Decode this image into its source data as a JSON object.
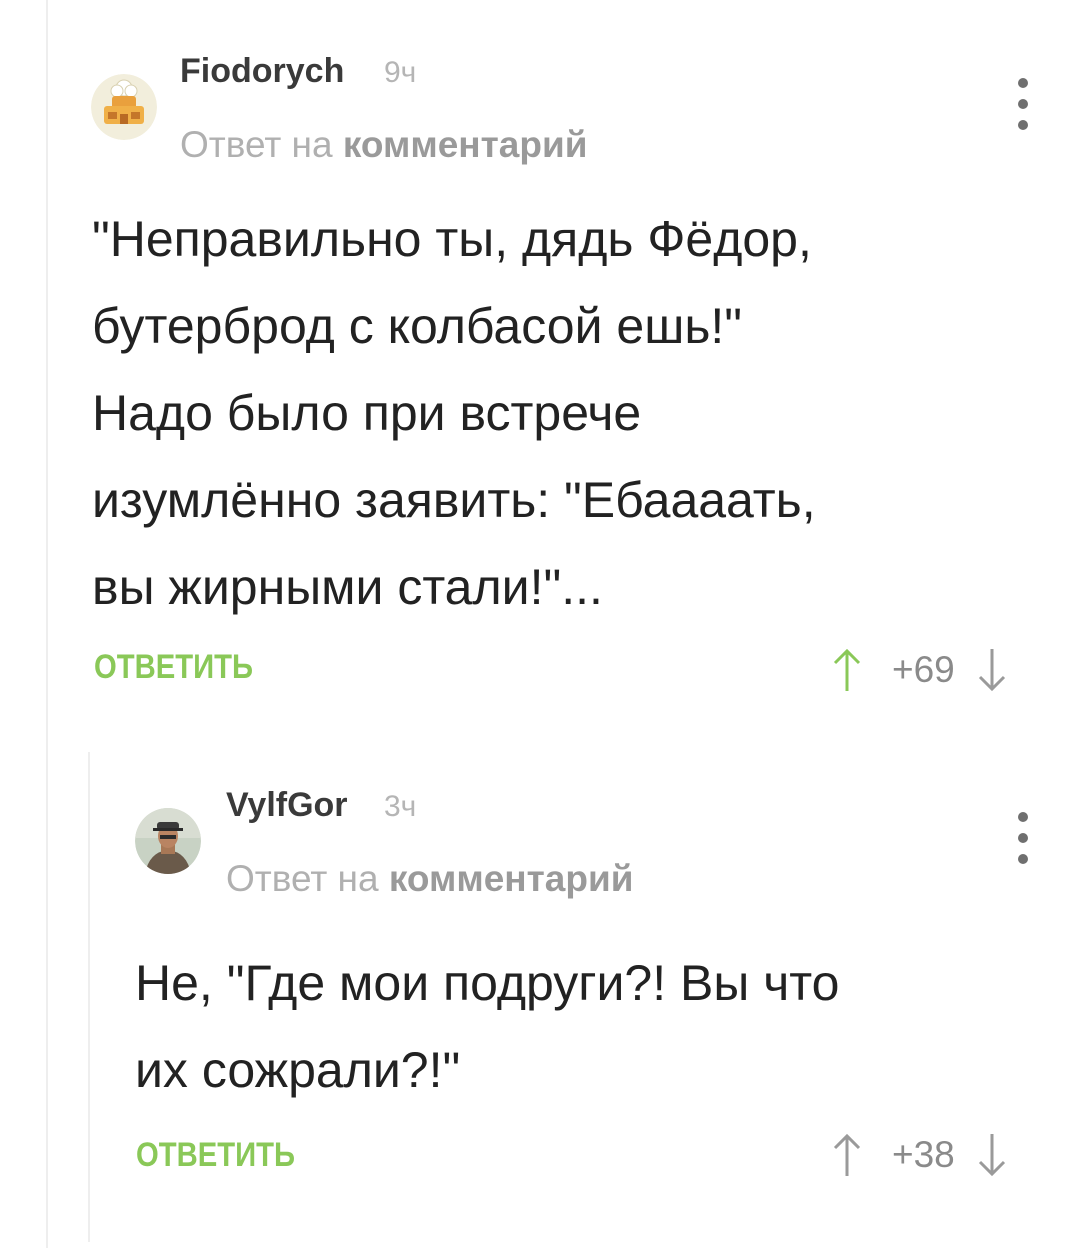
{
  "comments": [
    {
      "author": "Fiodorych",
      "time": "9ч",
      "reply_prefix": "Ответ на",
      "reply_link": "комментарий",
      "text": "\"Неправильно ты, дядь Фёдор,\nбутерброд с колбасой ешь!\"\nНадо было при встрече\nизумлённо заявить: \"Ебаааать,\nвы жирными стали!\"...",
      "reply_label": "ОТВЕТИТЬ",
      "rating": "+69",
      "avatar_icon": "chef-house-avatar-icon"
    },
    {
      "author": "VylfGor",
      "time": "3ч",
      "reply_prefix": "Ответ на",
      "reply_link": "комментарий",
      "text": "Не, \"Где мои подруги?! Вы что\nих сожрали?!\"",
      "reply_label": "ОТВЕТИТЬ",
      "rating": "+38",
      "avatar_icon": "user-photo-avatar-icon"
    }
  ],
  "colors": {
    "accent_green": "#8ac858",
    "upvote_green": "#8ac858",
    "downvote_gray": "#9a9a9a",
    "thread_line": "#eeeeee"
  }
}
